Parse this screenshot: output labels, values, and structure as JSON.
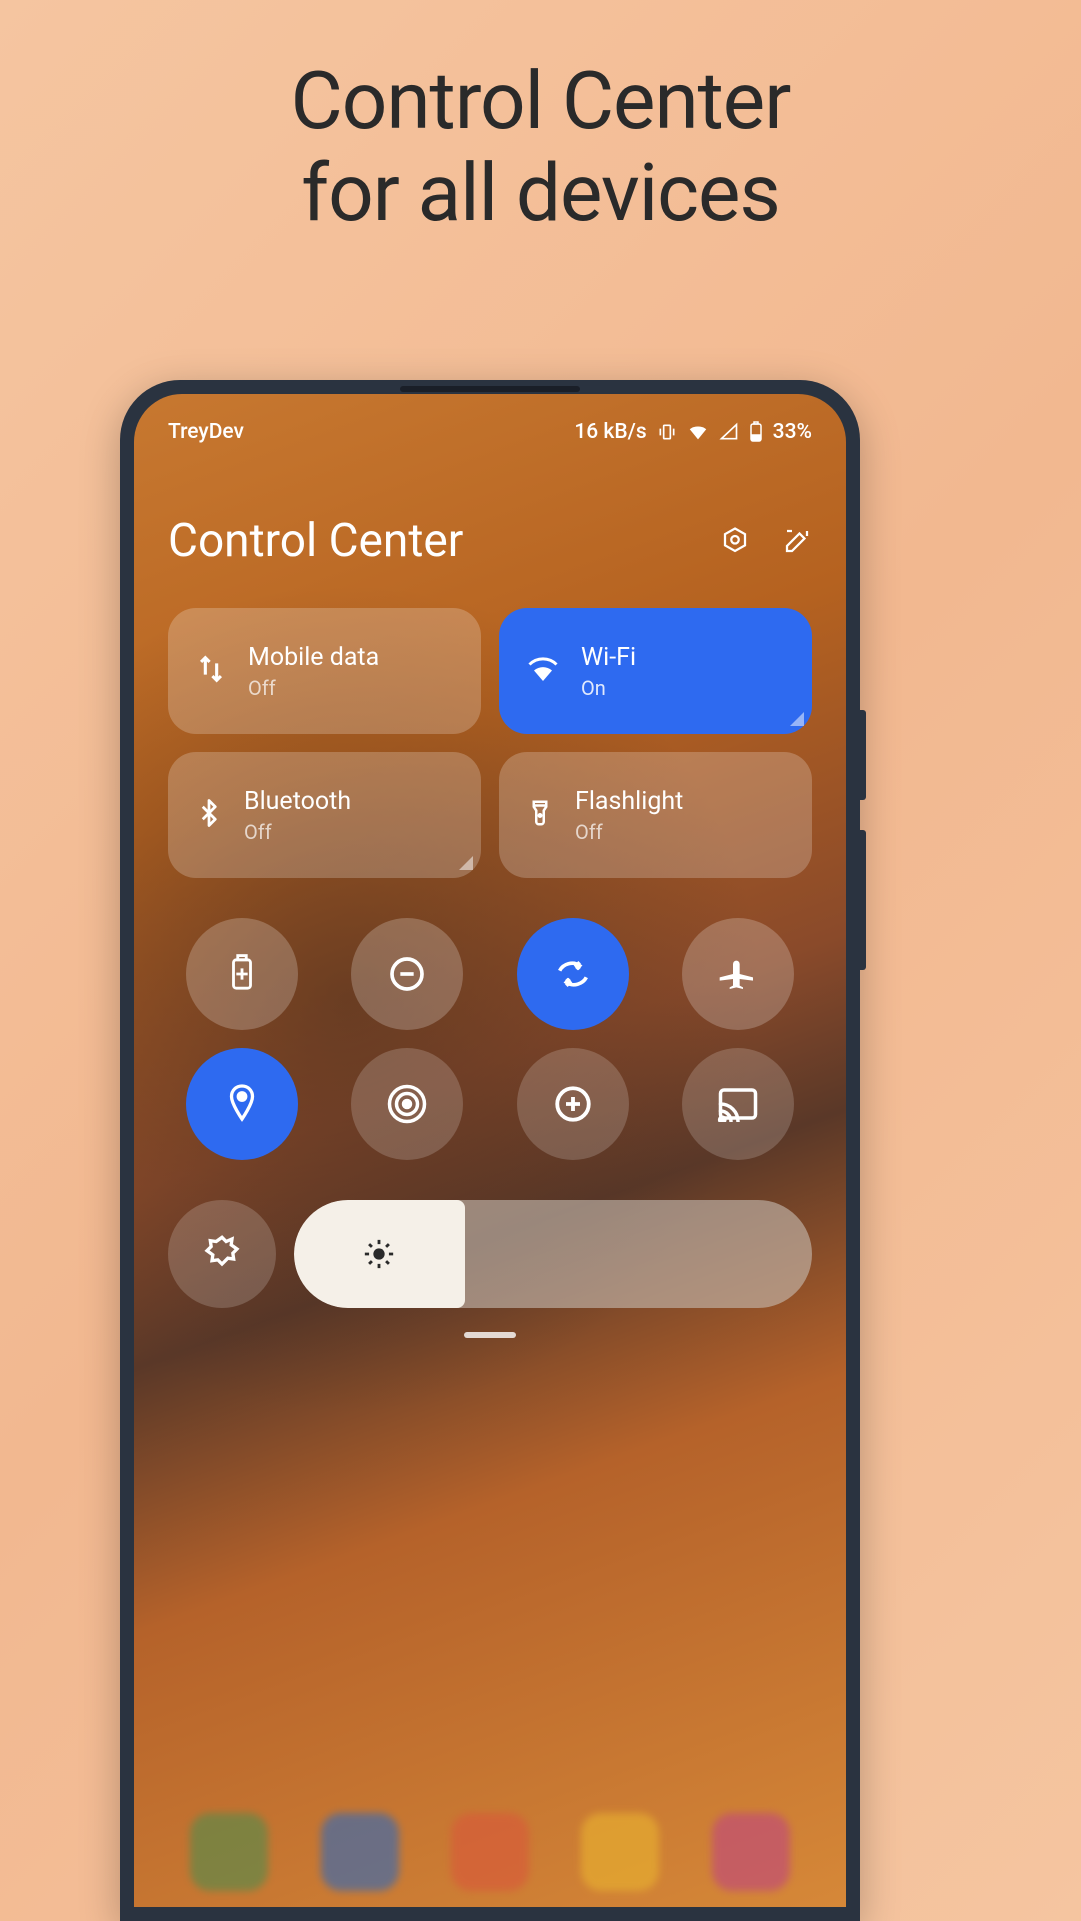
{
  "promo": {
    "line1": "Control Center",
    "line2": "for all devices"
  },
  "status": {
    "carrier": "TreyDev",
    "speed": "16 kB/s",
    "battery": "33%"
  },
  "header": {
    "title": "Control Center"
  },
  "tiles": [
    {
      "label": "Mobile data",
      "status": "Off",
      "icon": "swap-vert",
      "active": false,
      "corner": false
    },
    {
      "label": "Wi-Fi",
      "status": "On",
      "icon": "wifi",
      "active": true,
      "corner": true
    },
    {
      "label": "Bluetooth",
      "status": "Off",
      "icon": "bluetooth",
      "active": false,
      "corner": true
    },
    {
      "label": "Flashlight",
      "status": "Off",
      "icon": "flashlight",
      "active": false,
      "corner": false
    }
  ],
  "circles": [
    {
      "icon": "battery-saver",
      "active": false
    },
    {
      "icon": "dnd",
      "active": false
    },
    {
      "icon": "auto-rotate",
      "active": true
    },
    {
      "icon": "airplane",
      "active": false
    },
    {
      "icon": "location",
      "active": true
    },
    {
      "icon": "hotspot",
      "active": false
    },
    {
      "icon": "data-saver",
      "active": false
    },
    {
      "icon": "cast",
      "active": false
    }
  ],
  "brightness": {
    "auto_icon": "auto-brightness",
    "percent": 33
  },
  "colors": {
    "accent": "#2e6af0",
    "tile_bg": "rgba(255,255,255,0.22)"
  }
}
